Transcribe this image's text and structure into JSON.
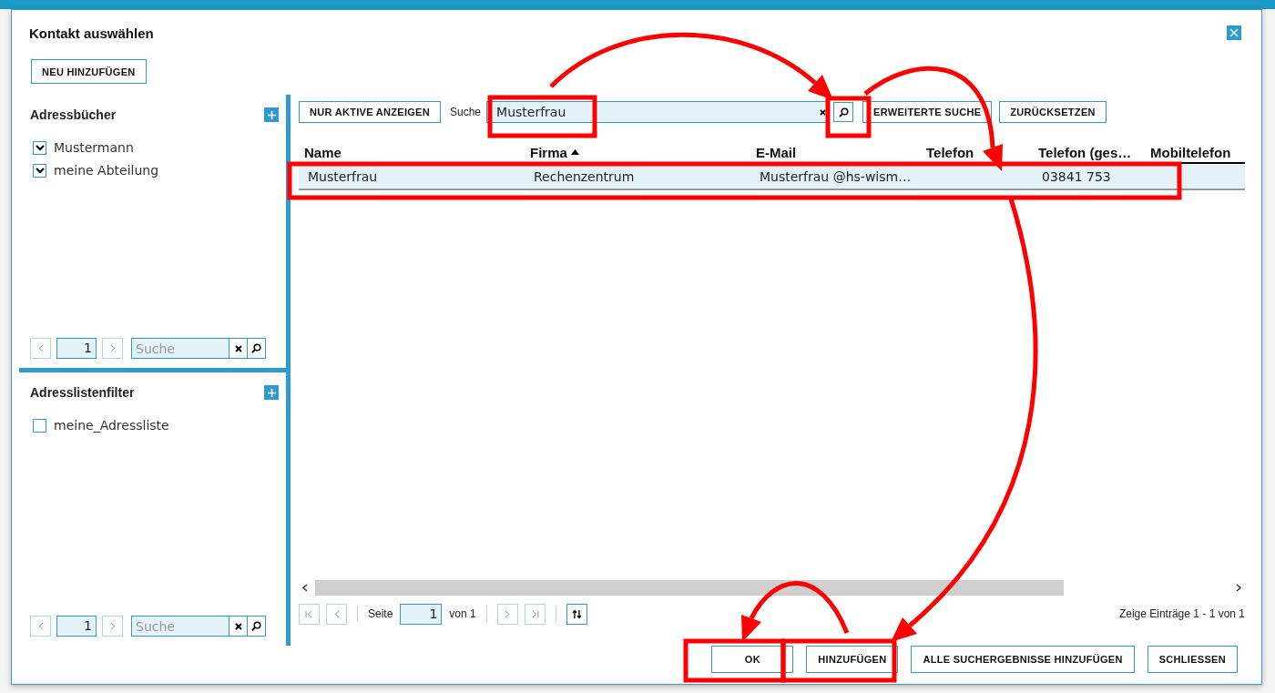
{
  "dialog": {
    "title": "Kontakt auswählen",
    "new_button": "NEU HINZUFÜGEN"
  },
  "address_books": {
    "title": "Adressbücher",
    "items": [
      {
        "label": "Mustermann",
        "checked": true
      },
      {
        "label": "meine Abteilung",
        "checked": true
      }
    ],
    "pager": {
      "page": "1",
      "search_placeholder": "Suche"
    }
  },
  "address_filters": {
    "title": "Adresslistenfilter",
    "items": [
      {
        "label": "meine_Adressliste",
        "checked": false
      }
    ],
    "pager": {
      "page": "1",
      "search_placeholder": "Suche"
    }
  },
  "toolbar": {
    "active_button": "NUR AKTIVE ANZEIGEN",
    "search_label": "Suche",
    "search_value": "Musterfrau",
    "advanced_button": "ERWEITERTE SUCHE",
    "reset_button": "ZURÜCKSETZEN"
  },
  "table": {
    "columns": [
      {
        "label": "Name",
        "sorted": false
      },
      {
        "label": "Firma",
        "sorted": true
      },
      {
        "label": "E-Mail",
        "sorted": false
      },
      {
        "label": "Telefon",
        "sorted": false
      },
      {
        "label": "Telefon (ges…",
        "sorted": false
      },
      {
        "label": "Mobiltelefon",
        "sorted": false
      }
    ],
    "rows": [
      {
        "selected": true,
        "cells": [
          "Musterfrau",
          "Rechenzentrum",
          "Musterfrau @hs-wism…",
          "",
          "03841 753",
          ""
        ]
      }
    ]
  },
  "pagination": {
    "page_label": "Seite",
    "page": "1",
    "of_label": "von 1",
    "summary": "Zeige Einträge 1 - 1 von 1"
  },
  "footer": {
    "buttons": [
      "OK",
      "HINZUFÜGEN",
      "ALLE SUCHERGEBNISSE HINZUFÜGEN",
      "SCHLIESSEN"
    ]
  }
}
